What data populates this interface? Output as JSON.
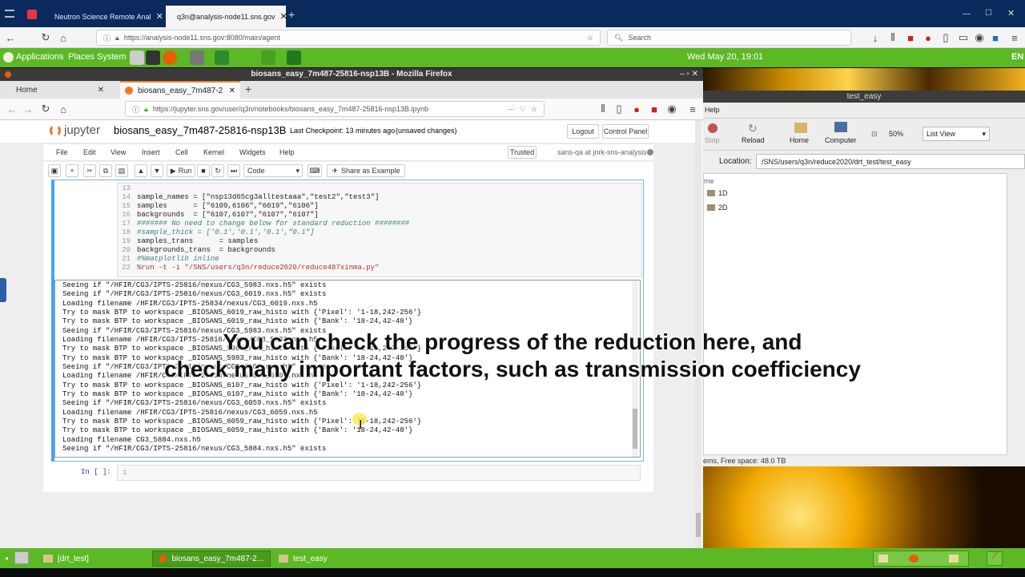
{
  "outer_browser": {
    "tabs": [
      {
        "label": "Neutron Science Remote Anal"
      },
      {
        "label": "q3n@analysis-node11.sns.gov"
      }
    ],
    "url": "https://analysis-node11.sns.gov:8080/main/agent",
    "search_placeholder": "Search"
  },
  "panel": {
    "applications": "Applications",
    "places": "Places",
    "system": "System",
    "clock": "Wed May 20, 19:01",
    "lang": "EN"
  },
  "inner_browser": {
    "window_title": "biosans_easy_7m487-25816-nsp13B - Mozilla Firefox",
    "tabs": [
      {
        "label": "Home"
      },
      {
        "label": "biosans_easy_7m487-2"
      }
    ],
    "url": "https://jupyter.sns.gov/user/q3n/notebooks/biosans_easy_7m487-25816-nsp13B.ipynb"
  },
  "jupyter": {
    "logo": "jupyter",
    "notebook_name": "biosans_easy_7m487-25816-nsp13B",
    "checkpoint": "Last Checkpoint: 13 minutes ago",
    "unsaved": "(unsaved changes)",
    "logout": "Logout",
    "control_panel": "Control Panel",
    "menu": [
      "File",
      "Edit",
      "View",
      "Insert",
      "Cell",
      "Kernel",
      "Widgets",
      "Help"
    ],
    "trusted": "Trusted",
    "kernel": "sans-qa at jnrk-sns-analysis",
    "toolbar": {
      "run": "Run",
      "cell_type": "Code",
      "share": "Share as Example"
    },
    "code_lines": [
      {
        "n": "13",
        "text": ""
      },
      {
        "n": "14",
        "text": "sample_names = [\"nsp13d65cg3alltestaaa\",\"test2\",\"test3\"]"
      },
      {
        "n": "15",
        "text": "samples      = [\"6109,6106\",\"6019\",\"6106\"]"
      },
      {
        "n": "16",
        "text": "backgrounds  = [\"6107,6107\",\"6107\",\"6107\"]"
      },
      {
        "n": "17",
        "text": "####### No need to change below for standard reduction ########"
      },
      {
        "n": "18",
        "text": "#sample_thick = ['0.1','0.1','0.1',\"0.1\"]"
      },
      {
        "n": "19",
        "text": "samples_trans      = samples"
      },
      {
        "n": "20",
        "text": "backgrounds_trans  = backgrounds"
      },
      {
        "n": "21",
        "text": "#%matplotlib inline"
      },
      {
        "n": "22",
        "text": "%run -t -i \"/SNS/users/q3n/reduce2020/reduce487xinma.py\""
      }
    ],
    "output_lines": [
      "Seeing if \"/HFIR/CG3/IPTS-25816/nexus/CG3_5983.nxs.h5\" exists",
      "Seeing if \"/HFIR/CG3/IPTS-25816/nexus/CG3_6019.nxs.h5\" exists",
      "Loading filename /HFIR/CG3/IPTS-25834/nexus/CG3_6019.nxs.h5",
      "Try to mask BTP to workspace _BIOSANS_6019_raw_histo with {'Pixel': '1-18,242-256'}",
      "Try to mask BTP to workspace _BIOSANS_6019_raw_histo with {'Bank': '18-24,42-48'}",
      "Seeing if \"/HFIR/CG3/IPTS-25816/nexus/CG3_5983.nxs.h5\" exists",
      "Loading filename /HFIR/CG3/IPTS-25816/nexus/CG3_5983.nxs.h5",
      "Try to mask BTP to workspace _BIOSANS_5983_raw_histo with {'Pixel': '1-18,242-256'}",
      "Try to mask BTP to workspace _BIOSANS_5983_raw_histo with {'Bank': '18-24,42-48'}",
      "Seeing if \"/HFIR/CG3/IPTS-25816/nexus/CG3_6107.nxs.h5\" exists",
      "Loading filename /HFIR/CG3/IPTS-25816/nexus/CG3_6107.nxs.h5",
      "Try to mask BTP to workspace _BIOSANS_6107_raw_histo with {'Pixel': '1-18,242-256'}",
      "Try to mask BTP to workspace _BIOSANS_6107_raw_histo with {'Bank': '18-24,42-48'}",
      "Seeing if \"/HFIR/CG3/IPTS-25816/nexus/CG3_6059.nxs.h5\" exists",
      "Loading filename /HFIR/CG3/IPTS-25816/nexus/CG3_6059.nxs.h5",
      "Try to mask BTP to workspace _BIOSANS_6059_raw_histo with {'Pixel': '1-18,242-256'}",
      "Try to mask BTP to workspace _BIOSANS_6059_raw_histo with {'Bank': '18-24,42-48'}",
      "Loading filename CG3_5884.nxs.h5",
      "Seeing if \"/HFIR/CG3/IPTS-25816/nexus/CG3_5884.nxs.h5\" exists"
    ],
    "empty_prompt": "In [ ]:",
    "empty_line_no": "1"
  },
  "caption": {
    "line1": "You can check the progress of the reduction here, and",
    "line2": "check many important factors, such as transmission coefficiency"
  },
  "file_manager": {
    "title": "test_easy",
    "menu_help": "Help",
    "buttons": [
      "Stop",
      "Reload",
      "Home",
      "Computer"
    ],
    "zoom": "50%",
    "view_mode": "List View",
    "location_label": "Location:",
    "location": "/SNS/users/q3n/reduce2020/drt_test/test_easy",
    "column_header": "me",
    "items": [
      "1D",
      "2D"
    ],
    "status": "ems, Free space: 48.0 TB"
  },
  "taskbar": {
    "items": [
      "[drt_test]",
      "biosans_easy_7m487-2...",
      "test_easy"
    ]
  }
}
